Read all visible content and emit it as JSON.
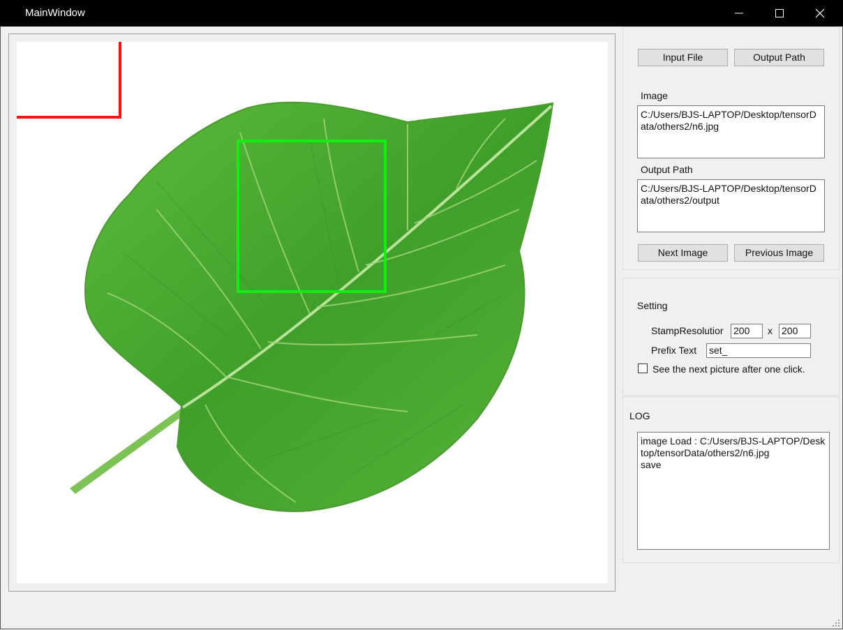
{
  "window": {
    "title": "MainWindow"
  },
  "files": {
    "input_button": "Input File",
    "output_button": "Output Path",
    "image_label": "Image",
    "image_path": "C:/Users/BJS-LAPTOP/Desktop/tensorData/others2/n6.jpg",
    "output_label": "Output Path",
    "output_path": "C:/Users/BJS-LAPTOP/Desktop/tensorData/others2/output",
    "next_button": "Next Image",
    "prev_button": "Previous Image"
  },
  "setting": {
    "title": "Setting",
    "stamp_label": "StampResolutior",
    "stamp_w": "200",
    "times": "x",
    "stamp_h": "200",
    "prefix_label": "Prefix Text",
    "prefix_value": "set_",
    "checkbox_label": "See the next picture after one click.",
    "checkbox_checked": false
  },
  "log": {
    "title": "LOG",
    "lines": [
      "image Load : C:/Users/BJS-LAPTOP/Desktop/tensorData/others2/n6.jpg",
      "save"
    ]
  },
  "colors": {
    "selection_box": "#ff1010",
    "stamp_box": "#11ee11"
  },
  "icons": [
    "minimize-icon",
    "maximize-icon",
    "close-icon",
    "leaf-image",
    "resize-grip-icon"
  ]
}
